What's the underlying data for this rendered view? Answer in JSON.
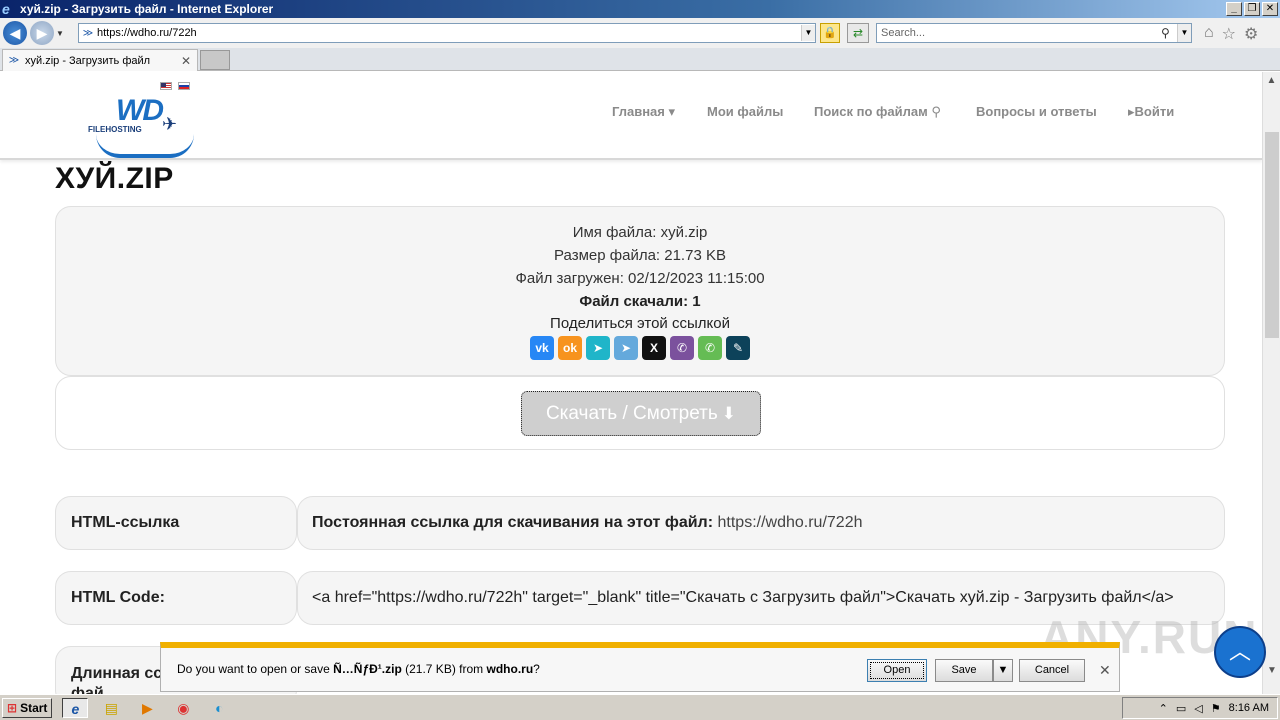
{
  "browser": {
    "window_title": "хуй.zip - Загрузить файл - Internet Explorer",
    "url": "https://wdho.ru/722h",
    "search_placeholder": "Search...",
    "tab_label": "хуй.zip - Загрузить файл"
  },
  "site": {
    "logo_text": "WD",
    "logo_sub": "FILEHOSTING",
    "nav": {
      "home": "Главная",
      "my_files": "Мои файлы",
      "search": "Поиск по файлам",
      "faq": "Вопросы и ответы",
      "login": "Войти"
    }
  },
  "file": {
    "title": "ХУЙ.ZIP",
    "name_line": "Имя файла: хуй.zip",
    "size_line": "Размер файла: 21.73 KB",
    "uploaded_line": "Файл загружен: 02/12/2023 11:15:00",
    "downloads_line": "Файл скачали: 1",
    "share_label": "Поделиться этой ссылкой",
    "download_button": "Скачать / Смотреть"
  },
  "share_buttons": [
    {
      "name": "vk",
      "glyph": "vk",
      "color": "#2787f5"
    },
    {
      "name": "odnoklassniki",
      "glyph": "ok",
      "color": "#f7931e"
    },
    {
      "name": "moimir",
      "glyph": "➤",
      "color": "#1fb5c9"
    },
    {
      "name": "telegram",
      "glyph": "➤",
      "color": "#64a9dc"
    },
    {
      "name": "x",
      "glyph": "X",
      "color": "#111111"
    },
    {
      "name": "viber",
      "glyph": "✆",
      "color": "#7b519d"
    },
    {
      "name": "whatsapp",
      "glyph": "✆",
      "color": "#65bc54"
    },
    {
      "name": "livejournal",
      "glyph": "✎",
      "color": "#0d425a"
    }
  ],
  "rows": {
    "html_link_label": "HTML-ссылка",
    "html_link_prefix": "Постоянная ссылка для скачивания на этот файл:",
    "html_link_url": "https://wdho.ru/722h",
    "html_code_label": "HTML Code:",
    "html_code_value": "<a href=\"https://wdho.ru/722h\" target=\"_blank\" title=\"Скачать с Загрузить файл\">Скачать хуй.zip - Загрузить файл</a>",
    "long_label": "Длинная сс",
    "long_label_2": "фай"
  },
  "download_bar": {
    "msg_prefix": "Do you want to open or save",
    "file": "Ñ…ÑƒÐ¹.zip",
    "size": "(21.7 KB) from",
    "host": "wdho.ru",
    "msg_suffix": "?",
    "open": "Open",
    "save": "Save",
    "cancel": "Cancel"
  },
  "watermark": "ANY.RUN",
  "taskbar": {
    "start": "Start",
    "clock": "8:16 AM"
  }
}
